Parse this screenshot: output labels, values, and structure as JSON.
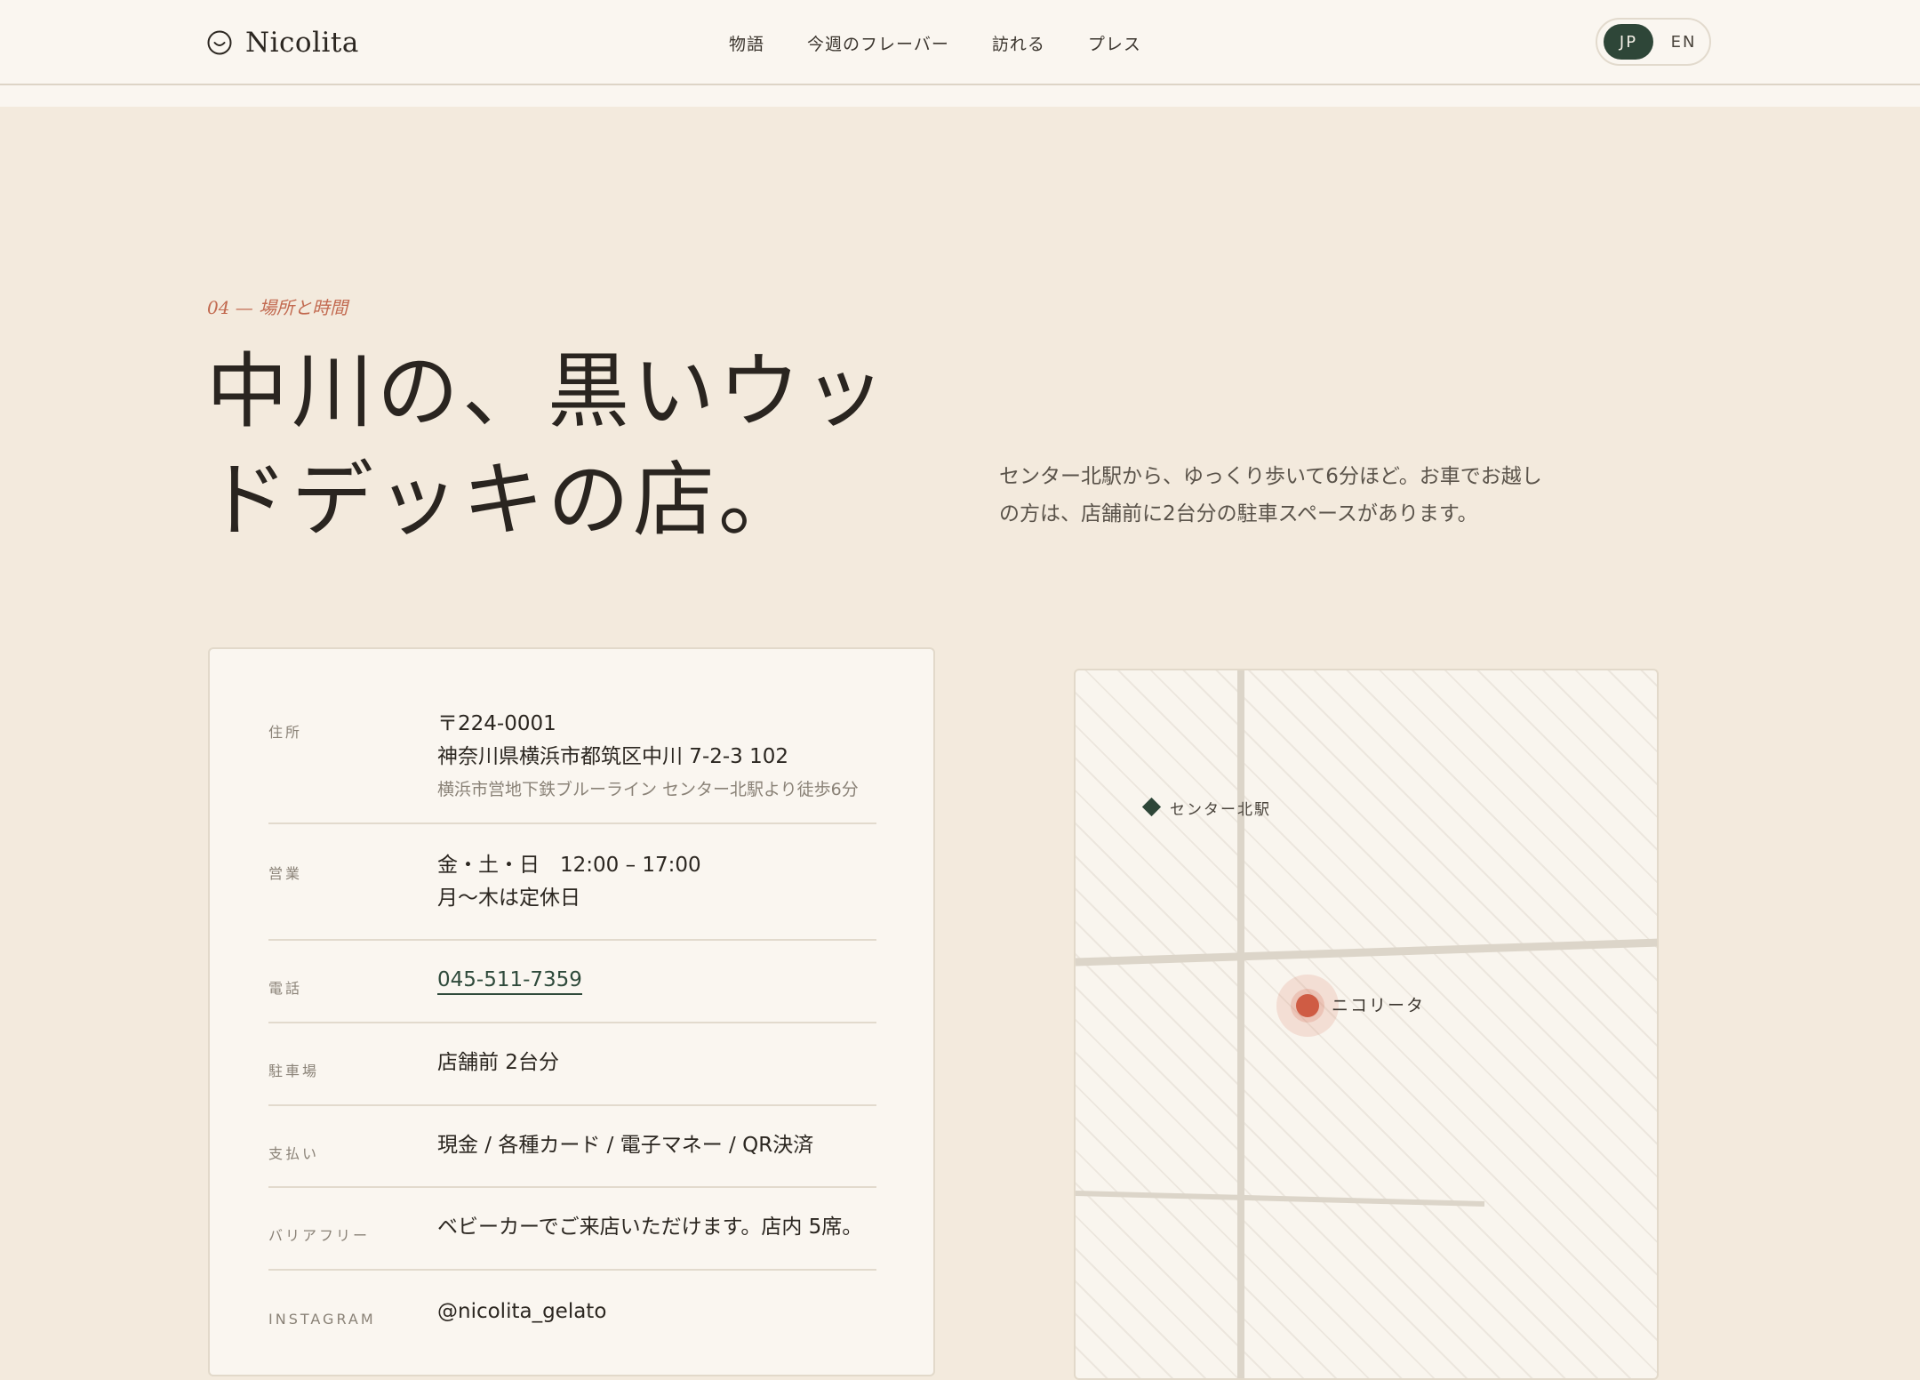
{
  "header": {
    "brand_name": "Nicolita",
    "nav": [
      "物語",
      "今週のフレーバー",
      "訪れる",
      "プレス"
    ],
    "lang": {
      "active": "JP",
      "other": "EN"
    }
  },
  "intro": {
    "eyebrow": "04 — 場所と時間",
    "headline_line1": "中川の、黒いウッ",
    "headline_line2": "ドデッキの店。",
    "lead": "センター北駅から、ゆっくり歩いて6分ほど。お車でお越しの方は、店舗前に2台分の駐車スペースがあります。"
  },
  "info": {
    "address": {
      "label": "住所",
      "postal": "〒224-0001",
      "street": "神奈川県横浜市都筑区中川 7-2-3 102",
      "access": "横浜市営地下鉄ブルーライン センター北駅より徒歩6分"
    },
    "hours": {
      "label": "営業",
      "open": "金・土・日　12:00 – 17:00",
      "closed": "月〜木は定休日"
    },
    "phone": {
      "label": "電話",
      "value": "045-511-7359"
    },
    "parking": {
      "label": "駐車場",
      "value": "店舗前 2台分"
    },
    "payment": {
      "label": "支払い",
      "value": "現金 / 各種カード / 電子マネー / QR決済"
    },
    "accessibility": {
      "label": "バリアフリー",
      "value": "ベビーカーでご来店いただけます。店内 5席。"
    },
    "instagram": {
      "label": "INSTAGRAM",
      "value": "@nicolita_gelato"
    }
  },
  "map": {
    "station_label": "センター北駅",
    "shop_label": "ニコリータ"
  },
  "colors": {
    "background": "#f3eadd",
    "header": "#faf6f0",
    "accent_green": "#2e4638",
    "accent_terracotta": "#cf5c44"
  },
  "icons": {
    "brand": "smile-circle-icon",
    "station": "diamond-marker-icon",
    "shop": "dot-marker-icon"
  }
}
